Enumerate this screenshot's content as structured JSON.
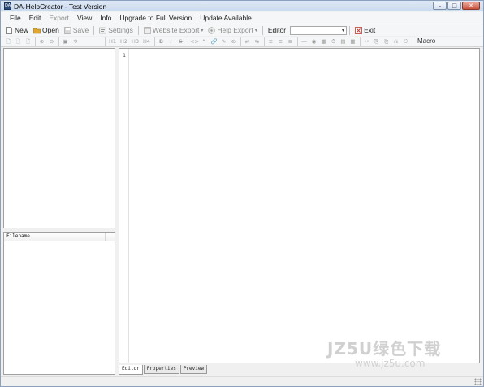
{
  "window": {
    "title": "DA-HelpCreator - Test Version",
    "icon_text": "DA",
    "controls": {
      "minimize": "–",
      "maximize": "□",
      "close": "✕"
    }
  },
  "menubar": {
    "items": [
      {
        "label": "File",
        "enabled": true
      },
      {
        "label": "Edit",
        "enabled": true
      },
      {
        "label": "Export",
        "enabled": false
      },
      {
        "label": "View",
        "enabled": true
      },
      {
        "label": "Info",
        "enabled": true
      },
      {
        "label": "Upgrade to Full Version",
        "enabled": true
      },
      {
        "label": "Update Available",
        "enabled": true
      }
    ]
  },
  "toolbar": {
    "new_label": "New",
    "open_label": "Open",
    "save_label": "Save",
    "settings_label": "Settings",
    "website_export_label": "Website Export",
    "help_export_label": "Help Export",
    "editor_label": "Editor",
    "editor_value": "",
    "exit_label": "Exit",
    "dropdown_arrow": "▾",
    "icons": {
      "new": "new-file-icon",
      "open": "open-folder-icon",
      "save": "save-icon",
      "settings": "settings-icon",
      "website_export": "website-export-icon",
      "help_export": "help-export-icon",
      "exit": "exit-icon"
    }
  },
  "format_toolbar": {
    "left_glyphs": [
      "🗋",
      "🗋",
      "🗋",
      "⊕",
      "⊖",
      "▣",
      "⟲"
    ],
    "headings": [
      "H1",
      "H2",
      "H3",
      "H4"
    ],
    "bold": "B",
    "italic": "I",
    "strike": "S",
    "misc_glyphs": [
      "<>",
      "❝",
      "🔗",
      "✎",
      "⊘",
      "⇄",
      "⇆",
      "≡",
      "≡",
      "≣",
      "―",
      "◉",
      "▦",
      "⏱",
      "▤",
      "▦",
      "✂",
      "⎘",
      "⎗",
      "⎌",
      "⎋"
    ],
    "macro_label": "Macro"
  },
  "file_list": {
    "column_filename": "Filename"
  },
  "editor": {
    "line_number": "1"
  },
  "tabs": [
    {
      "label": "Editor",
      "active": true
    },
    {
      "label": "Properties",
      "active": false
    },
    {
      "label": "Preview",
      "active": false
    }
  ],
  "watermark": {
    "main": "JZ5U绿色下载",
    "url": "www.jz5u.com"
  },
  "colors": {
    "accent": "#2c4a78",
    "exit_icon": "#c0392b",
    "open_icon": "#e0a52a"
  }
}
